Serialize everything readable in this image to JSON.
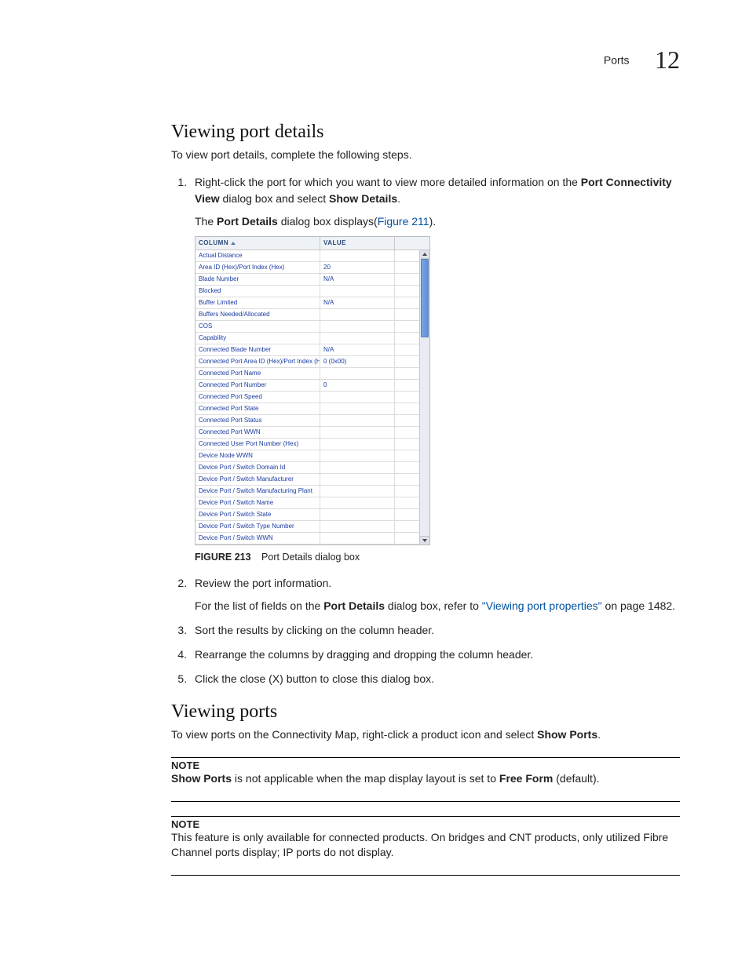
{
  "header": {
    "label": "Ports",
    "chapter": "12"
  },
  "sections": {
    "viewing_port_details": {
      "title": "Viewing port details",
      "lead": "To view port details, complete the following steps.",
      "step1_a": "Right-click the port for which you want to view more detailed information on the ",
      "step1_b": "Port Connectivity View",
      "step1_c": " dialog box and select ",
      "step1_d": "Show Details",
      "step1_e": ".",
      "step1_sub_a": "The ",
      "step1_sub_b": "Port Details",
      "step1_sub_c": " dialog box displays(",
      "step1_link": "Figure 211",
      "step1_sub_d": ").",
      "fig_caption_label": "FIGURE 213",
      "fig_caption_text": "Port Details dialog box",
      "table": {
        "header_col1": "COLUMN",
        "header_col2": "VALUE",
        "rows": [
          {
            "c1": "Actual Distance",
            "c2": ""
          },
          {
            "c1": "Area ID (Hex)/Port Index (Hex)",
            "c2": "20"
          },
          {
            "c1": "Blade Number",
            "c2": "N/A"
          },
          {
            "c1": "Blocked",
            "c2": ""
          },
          {
            "c1": "Buffer Limited",
            "c2": "N/A"
          },
          {
            "c1": "Buffers Needed/Allocated",
            "c2": ""
          },
          {
            "c1": "COS",
            "c2": ""
          },
          {
            "c1": "Capability",
            "c2": ""
          },
          {
            "c1": "Connected Blade Number",
            "c2": "N/A"
          },
          {
            "c1": "Connected Port Area ID (Hex)/Port Index (Hex)",
            "c2": "0 (0x00)"
          },
          {
            "c1": "Connected Port Name",
            "c2": ""
          },
          {
            "c1": "Connected Port Number",
            "c2": "0"
          },
          {
            "c1": "Connected Port Speed",
            "c2": ""
          },
          {
            "c1": "Connected Port State",
            "c2": ""
          },
          {
            "c1": "Connected Port Status",
            "c2": ""
          },
          {
            "c1": "Connected Port WWN",
            "c2": ""
          },
          {
            "c1": "Connected User Port Number (Hex)",
            "c2": ""
          },
          {
            "c1": "Device Node WWN",
            "c2": ""
          },
          {
            "c1": "Device Port / Switch Domain Id",
            "c2": ""
          },
          {
            "c1": "Device Port / Switch Manufacturer",
            "c2": ""
          },
          {
            "c1": "Device Port / Switch Manufacturing Plant",
            "c2": ""
          },
          {
            "c1": "Device Port / Switch Name",
            "c2": ""
          },
          {
            "c1": "Device Port / Switch State",
            "c2": ""
          },
          {
            "c1": "Device Port / Switch Type Number",
            "c2": ""
          },
          {
            "c1": "Device Port / Switch WWN",
            "c2": ""
          }
        ]
      },
      "step2": "Review the port information.",
      "step2_sub_a": "For the list of fields on the ",
      "step2_sub_b": "Port Details",
      "step2_sub_c": " dialog box, refer to ",
      "step2_link": "\"Viewing port properties\"",
      "step2_sub_d": " on page 1482.",
      "step3": "Sort the results by clicking on the column header.",
      "step4": "Rearrange the columns by dragging and dropping the column header.",
      "step5": "Click the close (X) button to close this dialog box."
    },
    "viewing_ports": {
      "title": "Viewing ports",
      "lead_a": "To view ports on the Connectivity Map, right-click a product icon and select ",
      "lead_b": "Show Ports",
      "lead_c": ".",
      "note_label": "NOTE",
      "note1_a": "Show Ports",
      "note1_b": " is not applicable when the map display layout is set to ",
      "note1_c": "Free Form",
      "note1_d": " (default).",
      "note2": "This feature is only available for connected products. On bridges and CNT products, only utilized Fibre Channel ports display; IP ports do not display."
    }
  }
}
